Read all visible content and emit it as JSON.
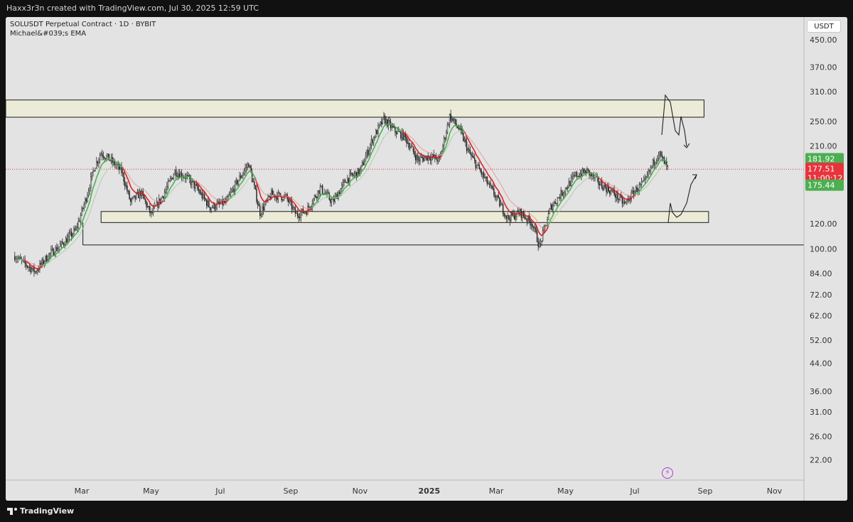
{
  "header": {
    "text": "Haxx3r3n created with TradingView.com, Jul 30, 2025 12:59 UTC"
  },
  "legend": {
    "line1": "SOLUSDT Perpetual Contract · 1D · BYBIT",
    "line2": "Michael&#039;s EMA"
  },
  "currency_label": "USDT",
  "footer": {
    "brand": "TradingView"
  },
  "colors": {
    "background": "#e3e3e3",
    "candle": "#2a2a2a",
    "ema_fast": "#d91f1f",
    "ema_slow": "#4caf50",
    "zone_fill": "#ebebd7",
    "current_price": "#e8323c"
  },
  "chart_data": {
    "type": "candlestick",
    "symbol": "SOLUSDT",
    "exchange": "BYBIT",
    "interval": "1D",
    "y_scale": "log",
    "y_ticks": [
      450,
      370,
      310,
      250,
      210,
      120,
      100,
      84,
      72,
      62,
      52,
      44,
      36,
      31,
      26,
      22
    ],
    "y_tick_labels": [
      "450.00",
      "370.00",
      "310.00",
      "250.00",
      "210.00",
      "120.00",
      "100.00",
      "84.00",
      "72.00",
      "62.00",
      "52.00",
      "44.00",
      "36.00",
      "31.00",
      "26.00",
      "22.00"
    ],
    "x_labels": [
      "Mar",
      "May",
      "Jul",
      "Sep",
      "Nov",
      "2025",
      "Mar",
      "May",
      "Jul",
      "Sep",
      "Nov"
    ],
    "price_markers": [
      {
        "label": "181.92",
        "value": 181.92,
        "color": "#4caf50"
      },
      {
        "label": "177.51",
        "sublabel": "11:00:12",
        "value": 177.51,
        "color": "#e8323c"
      },
      {
        "label": "175.44",
        "value": 175.44,
        "color": "#4caf50"
      }
    ],
    "path": [
      [
        "2024-01-02",
        95
      ],
      [
        "2024-01-20",
        85
      ],
      [
        "2024-02-01",
        96
      ],
      [
        "2024-02-12",
        103
      ],
      [
        "2024-02-25",
        115
      ],
      [
        "2024-03-05",
        145
      ],
      [
        "2024-03-12",
        180
      ],
      [
        "2024-03-18",
        200
      ],
      [
        "2024-03-26",
        190
      ],
      [
        "2024-04-05",
        175
      ],
      [
        "2024-04-13",
        140
      ],
      [
        "2024-04-22",
        150
      ],
      [
        "2024-05-01",
        128
      ],
      [
        "2024-05-12",
        148
      ],
      [
        "2024-05-22",
        175
      ],
      [
        "2024-06-01",
        168
      ],
      [
        "2024-06-10",
        155
      ],
      [
        "2024-06-22",
        135
      ],
      [
        "2024-07-06",
        140
      ],
      [
        "2024-07-15",
        160
      ],
      [
        "2024-07-26",
        185
      ],
      [
        "2024-08-05",
        130
      ],
      [
        "2024-08-15",
        148
      ],
      [
        "2024-08-28",
        145
      ],
      [
        "2024-09-06",
        128
      ],
      [
        "2024-09-15",
        132
      ],
      [
        "2024-09-27",
        155
      ],
      [
        "2024-10-08",
        140
      ],
      [
        "2024-10-20",
        165
      ],
      [
        "2024-11-01",
        175
      ],
      [
        "2024-11-12",
        220
      ],
      [
        "2024-11-22",
        255
      ],
      [
        "2024-12-01",
        235
      ],
      [
        "2024-12-10",
        225
      ],
      [
        "2024-12-22",
        190
      ],
      [
        "2025-01-01",
        195
      ],
      [
        "2025-01-10",
        190
      ],
      [
        "2025-01-19",
        260
      ],
      [
        "2025-01-28",
        235
      ],
      [
        "2025-02-05",
        200
      ],
      [
        "2025-02-17",
        170
      ],
      [
        "2025-03-01",
        145
      ],
      [
        "2025-03-11",
        125
      ],
      [
        "2025-03-22",
        130
      ],
      [
        "2025-04-02",
        120
      ],
      [
        "2025-04-08",
        102
      ],
      [
        "2025-04-18",
        135
      ],
      [
        "2025-04-28",
        150
      ],
      [
        "2025-05-10",
        170
      ],
      [
        "2025-05-20",
        175
      ],
      [
        "2025-05-31",
        160
      ],
      [
        "2025-06-12",
        150
      ],
      [
        "2025-06-22",
        138
      ],
      [
        "2025-07-01",
        152
      ],
      [
        "2025-07-10",
        162
      ],
      [
        "2025-07-17",
        185
      ],
      [
        "2025-07-22",
        200
      ],
      [
        "2025-07-30",
        177.51
      ]
    ],
    "zones": [
      {
        "from": "2023-12-25",
        "to": "2025-08-31",
        "low": 258,
        "high": 292
      },
      {
        "from": "2024-03-18",
        "to": "2025-09-04",
        "low": 121,
        "high": 131
      }
    ],
    "support_line": {
      "from": "2024-03-02",
      "value": 103
    },
    "current_price_line": 177.51,
    "x_range": [
      "2023-12-25",
      "2025-11-27"
    ],
    "y_range": [
      19,
      530
    ]
  }
}
